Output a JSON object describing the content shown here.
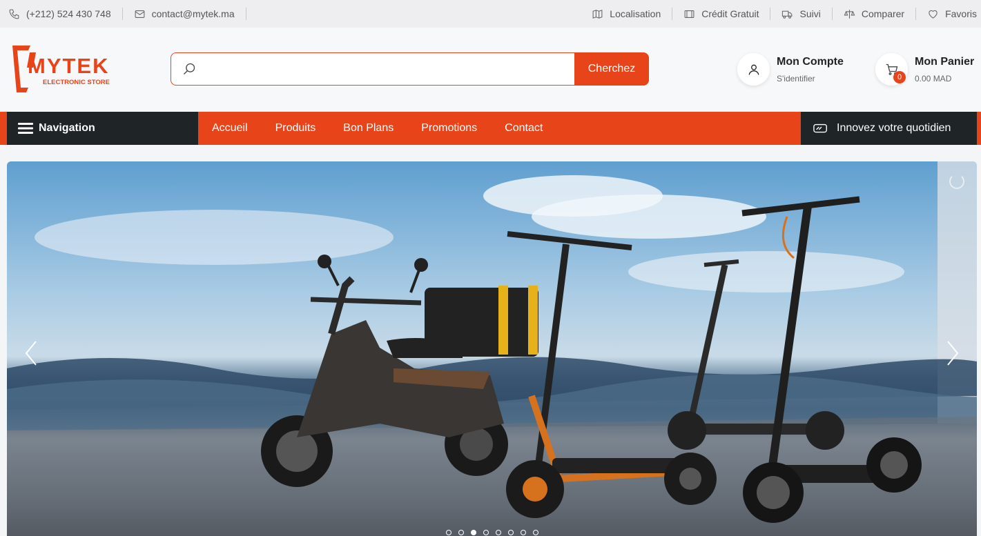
{
  "topbar": {
    "phone": "(+212) 524 430 748",
    "email": "contact@mytek.ma",
    "links": [
      "Localisation",
      "Crédit Gratuit",
      "Suivi",
      "Comparer",
      "Favoris"
    ]
  },
  "header": {
    "logo_text": "MYTEK",
    "logo_tagline": "ELECTRONIC STORE",
    "search_placeholder": "",
    "search_button": "Cherchez",
    "account_title": "Mon Compte",
    "account_sub": "S'identifier",
    "cart_title": "Mon Panier",
    "cart_sub": "0.00 MAD",
    "cart_count": "0"
  },
  "navbar": {
    "menu_label": "Navigation",
    "links": [
      "Accueil",
      "Produits",
      "Bon Plans",
      "Promotions",
      "Contact"
    ],
    "tagline": "Innovez votre quotidien"
  },
  "hero": {
    "slide_count": 8,
    "active_slide": 3
  },
  "colors": {
    "accent": "#e8441a",
    "dark": "#1f2427"
  }
}
